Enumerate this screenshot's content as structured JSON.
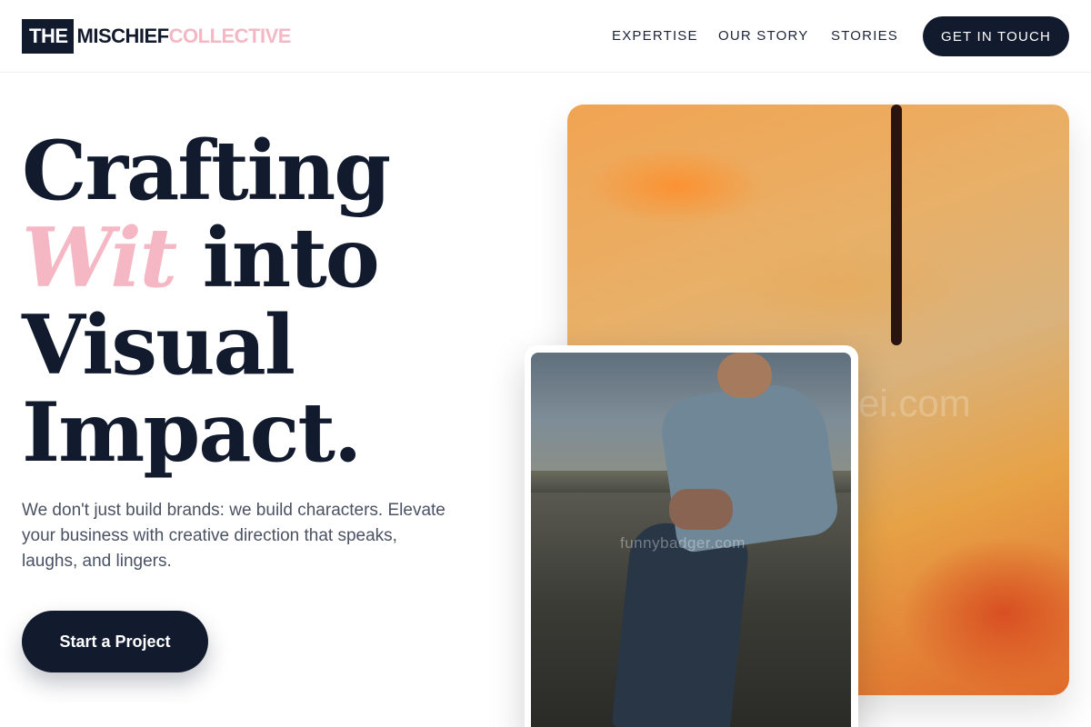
{
  "header": {
    "logo": {
      "part1": "THE",
      "part2": "MISCHIEF",
      "part3": "COLLECTIVE"
    },
    "nav": [
      "EXPERTISE",
      "OUR STORY",
      "STORIES"
    ],
    "cta": "GET IN TOUCH"
  },
  "hero": {
    "headline": {
      "line1": "Crafting",
      "line2_accent": "Wit",
      "line2_rest": " into",
      "line3": "Visual",
      "line4": "Impact."
    },
    "subtext": "We don't just build brands: we build characters. Elevate your business with creative direction that speaks, laughs, and lingers.",
    "cta": "Start a Project"
  },
  "images": {
    "art_watermark": "ei.com",
    "photo_watermark": "funnybadger.com"
  },
  "colors": {
    "navy": "#121a2e",
    "pink_accent": "#f6b7c5",
    "body_text": "#4a5263"
  }
}
